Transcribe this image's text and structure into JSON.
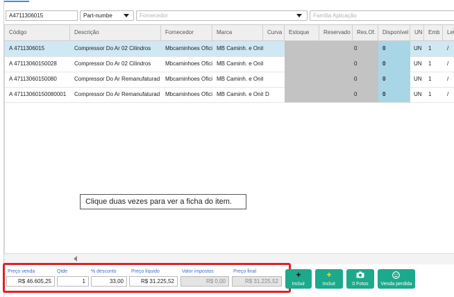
{
  "filters": {
    "code_value": "A4711306015",
    "type_select": "Part-numbe",
    "supplier_placeholder": "Fornecedor",
    "family_placeholder": "Família Aplicação"
  },
  "grid": {
    "columns": [
      "Código",
      "Descrição",
      "Fornecedor",
      "Marca",
      "Curva",
      "Estoque",
      "Reservado",
      "Res.Of.",
      "Disponível",
      "UN",
      "Emb",
      "Let"
    ],
    "rows": [
      {
        "codigo": "A 4711306015",
        "descricao": "Compressor Do Ar 02 Cilindros",
        "fornecedor": "Mbcaminhoes Ofici",
        "marca": "MB Caminh. e Onit",
        "curva": "",
        "resof": "0",
        "disponivel": "0",
        "un": "UN",
        "emb": "1",
        "let": "/"
      },
      {
        "codigo": "A 47113060150028",
        "descricao": "Compressor Do Ar 02 Cilindros",
        "fornecedor": "Mbcaminhoes Ofici",
        "marca": "MB Caminh. e Onit",
        "curva": "",
        "resof": "0",
        "disponivel": "0",
        "un": "UN",
        "emb": "1",
        "let": "/"
      },
      {
        "codigo": "A 47113060150080",
        "descricao": "Compressor Do Ar Remanufaturad",
        "fornecedor": "Mbcaminhoes Ofici",
        "marca": "MB Caminh. e Onit",
        "curva": "",
        "resof": "0",
        "disponivel": "0",
        "un": "UN",
        "emb": "1",
        "let": "/"
      },
      {
        "codigo": "A 47113060150080001",
        "descricao": "Compressor Do Ar Remanufaturad",
        "fornecedor": "Mbcaminhoes Ofici",
        "marca": "MB Caminh. e Onit",
        "curva": "D",
        "resof": "0",
        "disponivel": "0",
        "un": "UN",
        "emb": "1",
        "let": "/"
      }
    ]
  },
  "tooltip": "Clique duas vezes para ver a ficha do item.",
  "pricing": {
    "preco_venda_label": "Preço venda",
    "preco_venda": "R$ 46.605,25",
    "qtde_label": "Qtde",
    "qtde": "1",
    "desconto_label": "% desconto",
    "desconto": "33,00",
    "preco_liquido_label": "Preço líquido",
    "preco_liquido": "R$ 31.225,52",
    "valor_impostos_label": "Valor impostos",
    "valor_impostos": "R$ 0,00",
    "preco_final_label": "Preço final",
    "preco_final": "R$ 31.225,52"
  },
  "actions": {
    "incluir_1": "Incluir",
    "incluir_2": "Incluir",
    "fotos": "0 Fotos",
    "venda_perdida": "Venda perdida"
  },
  "colors": {
    "accent": "#1ca98c",
    "selection": "#cfe8f4",
    "available": "#a9d6e6",
    "stock": "#c3c3c3",
    "highlight": "#e21e26"
  }
}
